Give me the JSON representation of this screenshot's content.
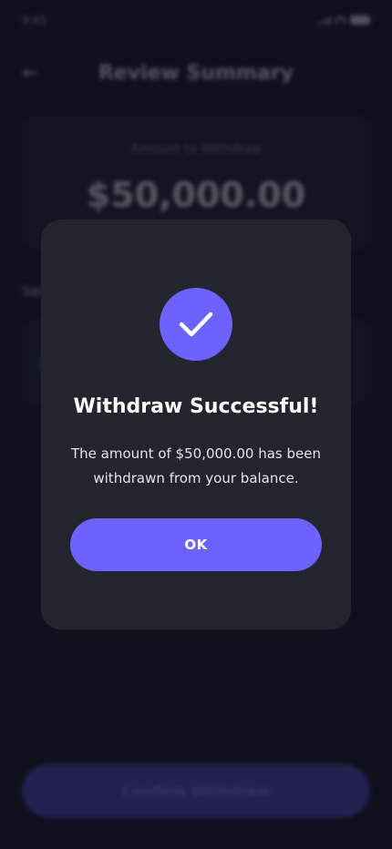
{
  "status_bar": {
    "time": "9:41"
  },
  "header": {
    "title": "Review Summary",
    "back_icon": "arrow-left-icon"
  },
  "amount_card": {
    "label": "Amount to Withdraw",
    "value": "$50,000.00"
  },
  "method_section": {
    "label": "Select Method"
  },
  "confirm_button": {
    "label": "Confirm Withdraw"
  },
  "dialog": {
    "icon": "checkmark-icon",
    "title": "Withdraw Successful!",
    "message": "The amount of $50,000.00 has been withdrawn from your balance.",
    "ok_label": "OK"
  },
  "colors": {
    "background": "#121521",
    "card": "#1c1f2b",
    "dialog": "#22242e",
    "accent": "#6c63ff"
  }
}
